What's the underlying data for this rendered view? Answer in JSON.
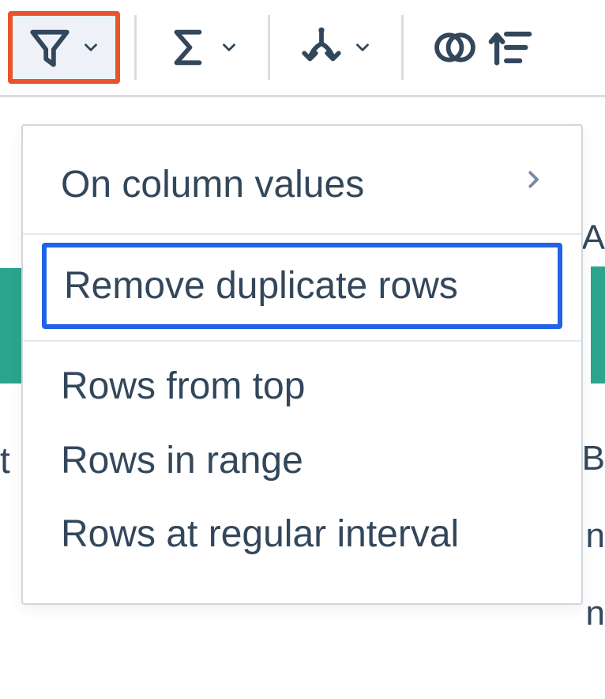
{
  "toolbar": {
    "filter": {
      "name": "filter-dropdown"
    },
    "aggregate": {
      "name": "aggregate-dropdown"
    },
    "split": {
      "name": "split-dropdown"
    },
    "join": {
      "name": "join-button"
    },
    "sort": {
      "name": "sort-button"
    }
  },
  "menu": {
    "on_column_values": "On column values",
    "remove_duplicate_rows": "Remove duplicate rows",
    "rows_from_top": "Rows from top",
    "rows_in_range": "Rows in range",
    "rows_at_regular_interval": "Rows at regular interval"
  },
  "bg": {
    "a": "A",
    "t": "t",
    "b": "B",
    "n1": "n",
    "n2": "n"
  }
}
